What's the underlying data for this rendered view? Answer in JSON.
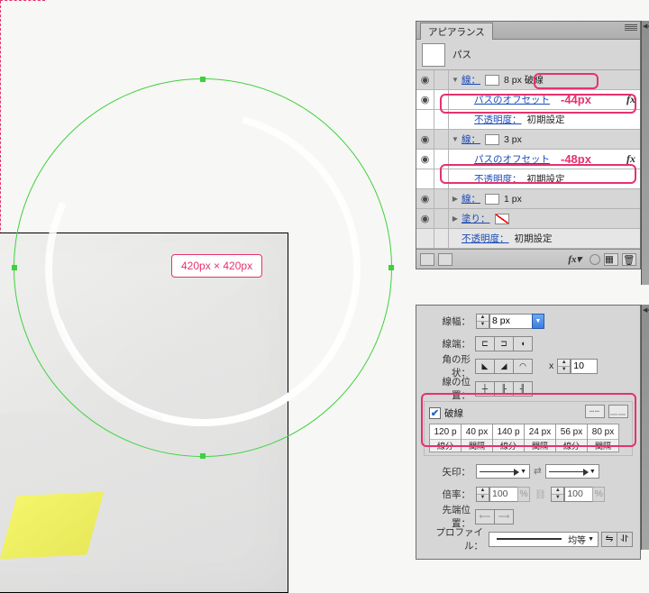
{
  "canvas": {
    "dimension_label": "420px × 420px"
  },
  "appearance": {
    "panel_title": "アピアランス",
    "object_type": "パス",
    "rows": {
      "stroke1_label": "線：",
      "stroke1_value": "8 px 破線",
      "offset1_link": "パスのオフセット",
      "offset1_value": "-44px",
      "opacity_label": "不透明度：",
      "opacity_value": "初期設定",
      "stroke2_label": "線：",
      "stroke2_value": "3 px",
      "offset2_link": "パスのオフセット",
      "offset2_value": "-48px",
      "stroke3_label": "線：",
      "stroke3_value": "1 px",
      "fill_label": "塗り：",
      "final_opacity_label": "不透明度：",
      "final_opacity_value": "初期設定"
    }
  },
  "stroke": {
    "weight_label": "線幅：",
    "weight_value": "8 px",
    "cap_label": "線端：",
    "join_label": "角の形状：",
    "miter_x": "x",
    "miter_value": "10",
    "align_label": "線の位置：",
    "dash_check_label": "破線",
    "dash_cells": [
      {
        "v": "120 p",
        "l": "線分"
      },
      {
        "v": "40 px",
        "l": "間隔"
      },
      {
        "v": "140 p",
        "l": "線分"
      },
      {
        "v": "24 px",
        "l": "間隔"
      },
      {
        "v": "56 px",
        "l": "線分"
      },
      {
        "v": "80 px",
        "l": "間隔"
      }
    ],
    "arrow_label": "矢印：",
    "scale_label": "倍率：",
    "scale_a": "100",
    "scale_pct": "%",
    "scale_b": "100",
    "tip_label": "先端位置：",
    "profile_label": "プロファイル：",
    "profile_value": "均等"
  }
}
